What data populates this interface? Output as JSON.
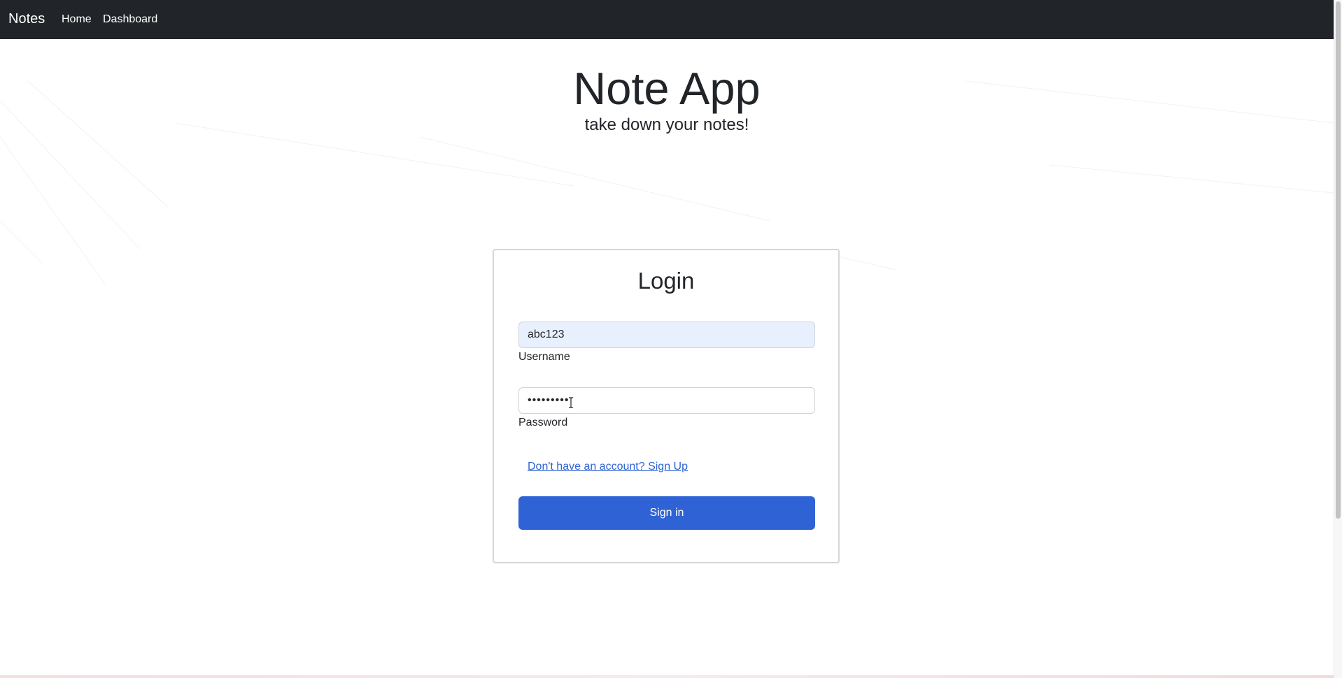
{
  "navbar": {
    "brand": "Notes",
    "links": [
      {
        "label": "Home"
      },
      {
        "label": "Dashboard"
      }
    ]
  },
  "hero": {
    "title": "Note App",
    "subtitle": "take down your notes!"
  },
  "login": {
    "title": "Login",
    "username": {
      "value": "abc123",
      "label": "Username"
    },
    "password": {
      "value": "•••••••••",
      "label": "Password"
    },
    "signup_link": "Don't have an account? Sign Up",
    "submit_label": "Sign in"
  },
  "colors": {
    "navbar_bg": "#212529",
    "primary": "#2f63d5",
    "autofill_bg": "#e8f0fe"
  }
}
